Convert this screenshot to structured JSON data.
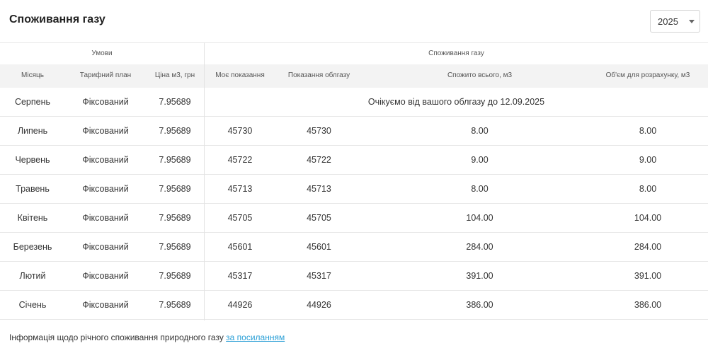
{
  "header": {
    "title": "Споживання газу",
    "year": "2025"
  },
  "groups": {
    "conditions": "Умови",
    "consumption": "Споживання газу"
  },
  "columns": [
    "Місяць",
    "Тарифний план",
    "Ціна м3, грн",
    "Моє показання",
    "Показання облгазу",
    "Спожито всього, м3",
    "Об'єм для розрахунку, м3"
  ],
  "rows": [
    {
      "month": "Серпень",
      "plan": "Фіксований",
      "price": "7.95689",
      "notice": "Очікуємо від вашого облгазу до 12.09.2025"
    },
    {
      "month": "Липень",
      "plan": "Фіксований",
      "price": "7.95689",
      "mine": "45730",
      "obl": "45730",
      "total": "8.00",
      "calc": "8.00"
    },
    {
      "month": "Червень",
      "plan": "Фіксований",
      "price": "7.95689",
      "mine": "45722",
      "obl": "45722",
      "total": "9.00",
      "calc": "9.00"
    },
    {
      "month": "Травень",
      "plan": "Фіксований",
      "price": "7.95689",
      "mine": "45713",
      "obl": "45713",
      "total": "8.00",
      "calc": "8.00"
    },
    {
      "month": "Квітень",
      "plan": "Фіксований",
      "price": "7.95689",
      "mine": "45705",
      "obl": "45705",
      "total": "104.00",
      "calc": "104.00"
    },
    {
      "month": "Березень",
      "plan": "Фіксований",
      "price": "7.95689",
      "mine": "45601",
      "obl": "45601",
      "total": "284.00",
      "calc": "284.00"
    },
    {
      "month": "Лютий",
      "plan": "Фіксований",
      "price": "7.95689",
      "mine": "45317",
      "obl": "45317",
      "total": "391.00",
      "calc": "391.00"
    },
    {
      "month": "Січень",
      "plan": "Фіксований",
      "price": "7.95689",
      "mine": "44926",
      "obl": "44926",
      "total": "386.00",
      "calc": "386.00"
    }
  ],
  "footer": {
    "text": "Інформація щодо річного споживання природного газу ",
    "link": "за посиланням"
  }
}
